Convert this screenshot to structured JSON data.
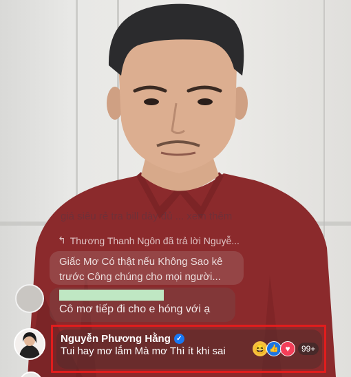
{
  "comments": {
    "faded_text": "giá siêu rẻ tra bill dày đủ ... xem thêm",
    "reply_indicator": "Thương Thanh Ngôn đã trả lời Nguyễ...",
    "reply_text": "Giấc Mơ Có thật nếu Không Sao kê trước Công chúng cho mọi người...",
    "comment_2_text": "Cô mơ tiếp đi cho e hóng với ạ",
    "highlighted": {
      "author": "Nguyễn Phương Hằng",
      "text": "Tui hay mơ lắm Mà mơ Thì ít khi sai",
      "reaction_count": "99+"
    }
  },
  "colors": {
    "highlight_border": "#e11d1d",
    "verified_badge": "#1877f2",
    "shirt": "#8b2a2c"
  },
  "icons": [
    "reply-arrow-icon",
    "verified-badge-icon",
    "haha-reaction-icon",
    "like-reaction-icon",
    "love-reaction-icon"
  ]
}
